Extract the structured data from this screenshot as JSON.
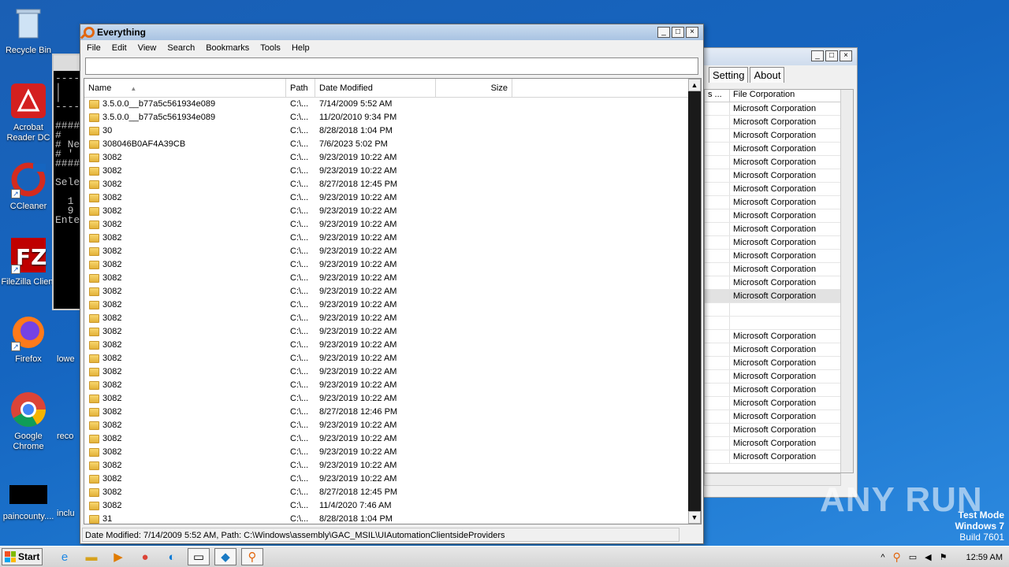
{
  "desktop": {
    "icons": [
      {
        "label": "Recycle Bin"
      },
      {
        "label": "Acrobat Reader DC"
      },
      {
        "label": "CCleaner"
      },
      {
        "label": "FileZilla Client"
      },
      {
        "label": "Firefox"
      },
      {
        "label": "Google Chrome"
      },
      {
        "label": "paincounty...."
      }
    ],
    "partial_labels": [
      "lowe",
      "reco",
      "inclu"
    ]
  },
  "console": {
    "lines": [
      "-----",
      "|",
      "|",
      "-----",
      "",
      "####",
      "#",
      "# Ne",
      "# '",
      "####",
      "",
      "Sele",
      "  ",
      "  1",
      "  9",
      "Ente"
    ]
  },
  "bg_window": {
    "tabs": [
      "Setting",
      "About"
    ],
    "col_header_1": "s ...",
    "col_header_2": "File Corporation",
    "rows": [
      "Microsoft Corporation",
      "Microsoft Corporation",
      "Microsoft Corporation",
      "Microsoft Corporation",
      "Microsoft Corporation",
      "Microsoft Corporation",
      "Microsoft Corporation",
      "Microsoft Corporation",
      "Microsoft Corporation",
      "Microsoft Corporation",
      "Microsoft Corporation",
      "Microsoft Corporation",
      "Microsoft Corporation",
      "Microsoft Corporation",
      "Microsoft Corporation",
      "",
      "",
      "Microsoft Corporation",
      "Microsoft Corporation",
      "Microsoft Corporation",
      "Microsoft Corporation",
      "Microsoft Corporation",
      "Microsoft Corporation",
      "Microsoft Corporation",
      "Microsoft Corporation",
      "Microsoft Corporation",
      "Microsoft Corporation"
    ]
  },
  "everything": {
    "title": "Everything",
    "menu": [
      "File",
      "Edit",
      "View",
      "Search",
      "Bookmarks",
      "Tools",
      "Help"
    ],
    "search_value": "",
    "columns": {
      "name": "Name",
      "path": "Path",
      "date": "Date Modified",
      "size": "Size"
    },
    "rows": [
      {
        "name": "3.5.0.0__b77a5c561934e089",
        "path": "C:\\...",
        "date": "7/14/2009 5:52 AM"
      },
      {
        "name": "3.5.0.0__b77a5c561934e089",
        "path": "C:\\...",
        "date": "11/20/2010 9:34 PM"
      },
      {
        "name": "30",
        "path": "C:\\...",
        "date": "8/28/2018 1:04 PM"
      },
      {
        "name": "308046B0AF4A39CB",
        "path": "C:\\...",
        "date": "7/6/2023 5:02 PM"
      },
      {
        "name": "3082",
        "path": "C:\\...",
        "date": "9/23/2019 10:22 AM"
      },
      {
        "name": "3082",
        "path": "C:\\...",
        "date": "9/23/2019 10:22 AM"
      },
      {
        "name": "3082",
        "path": "C:\\...",
        "date": "8/27/2018 12:45 PM"
      },
      {
        "name": "3082",
        "path": "C:\\...",
        "date": "9/23/2019 10:22 AM"
      },
      {
        "name": "3082",
        "path": "C:\\...",
        "date": "9/23/2019 10:22 AM"
      },
      {
        "name": "3082",
        "path": "C:\\...",
        "date": "9/23/2019 10:22 AM"
      },
      {
        "name": "3082",
        "path": "C:\\...",
        "date": "9/23/2019 10:22 AM"
      },
      {
        "name": "3082",
        "path": "C:\\...",
        "date": "9/23/2019 10:22 AM"
      },
      {
        "name": "3082",
        "path": "C:\\...",
        "date": "9/23/2019 10:22 AM"
      },
      {
        "name": "3082",
        "path": "C:\\...",
        "date": "9/23/2019 10:22 AM"
      },
      {
        "name": "3082",
        "path": "C:\\...",
        "date": "9/23/2019 10:22 AM"
      },
      {
        "name": "3082",
        "path": "C:\\...",
        "date": "9/23/2019 10:22 AM"
      },
      {
        "name": "3082",
        "path": "C:\\...",
        "date": "9/23/2019 10:22 AM"
      },
      {
        "name": "3082",
        "path": "C:\\...",
        "date": "9/23/2019 10:22 AM"
      },
      {
        "name": "3082",
        "path": "C:\\...",
        "date": "9/23/2019 10:22 AM"
      },
      {
        "name": "3082",
        "path": "C:\\...",
        "date": "9/23/2019 10:22 AM"
      },
      {
        "name": "3082",
        "path": "C:\\...",
        "date": "9/23/2019 10:22 AM"
      },
      {
        "name": "3082",
        "path": "C:\\...",
        "date": "9/23/2019 10:22 AM"
      },
      {
        "name": "3082",
        "path": "C:\\...",
        "date": "9/23/2019 10:22 AM"
      },
      {
        "name": "3082",
        "path": "C:\\...",
        "date": "8/27/2018 12:46 PM"
      },
      {
        "name": "3082",
        "path": "C:\\...",
        "date": "9/23/2019 10:22 AM"
      },
      {
        "name": "3082",
        "path": "C:\\...",
        "date": "9/23/2019 10:22 AM"
      },
      {
        "name": "3082",
        "path": "C:\\...",
        "date": "9/23/2019 10:22 AM"
      },
      {
        "name": "3082",
        "path": "C:\\...",
        "date": "9/23/2019 10:22 AM"
      },
      {
        "name": "3082",
        "path": "C:\\...",
        "date": "9/23/2019 10:22 AM"
      },
      {
        "name": "3082",
        "path": "C:\\...",
        "date": "8/27/2018 12:45 PM"
      },
      {
        "name": "3082",
        "path": "C:\\...",
        "date": "11/4/2020 7:46 AM"
      },
      {
        "name": "31",
        "path": "C:\\...",
        "date": "8/28/2018 1:04 PM"
      }
    ],
    "status": "Date Modified: 7/14/2009 5:52 AM, Path: C:\\Windows\\assembly\\GAC_MSIL\\UIAutomationClientsideProviders"
  },
  "watermark": "ANY RUN",
  "testmode": {
    "line1": "Test Mode",
    "line2": "Windows 7",
    "line3": "Build 7601"
  },
  "taskbar": {
    "start_label": "Start",
    "clock": "12:59 AM"
  }
}
